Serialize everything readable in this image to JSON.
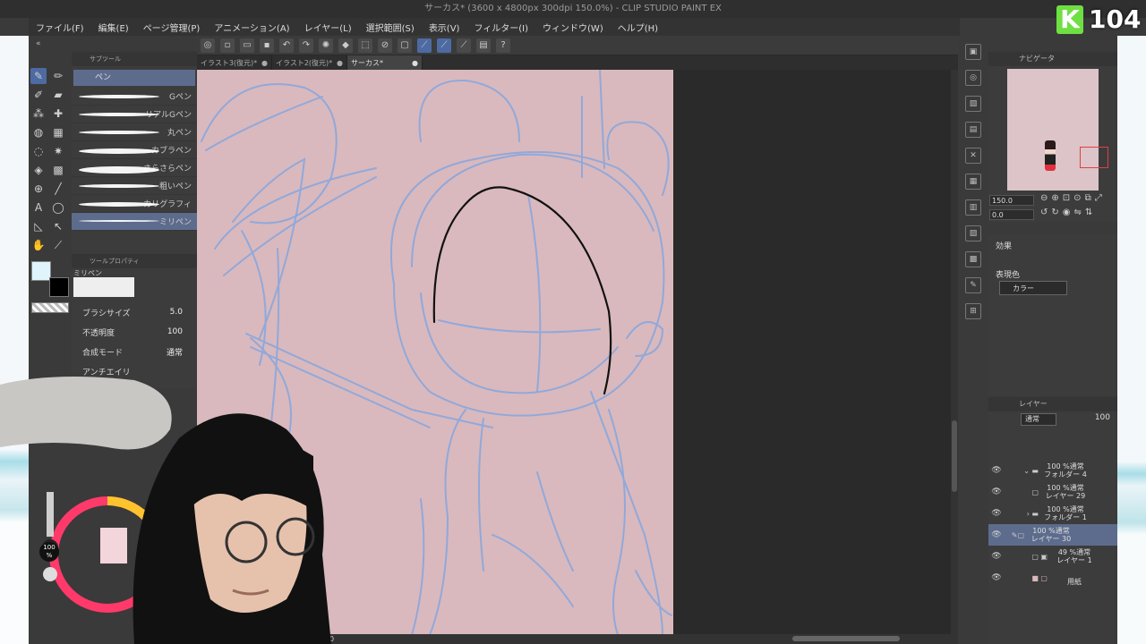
{
  "window": {
    "title": "サーカス* (3600 x 4800px 300dpi 150.0%) - CLIP STUDIO PAINT EX"
  },
  "menu": [
    "ファイル(F)",
    "編集(E)",
    "ページ管理(P)",
    "アニメーション(A)",
    "レイヤー(L)",
    "選択範囲(S)",
    "表示(V)",
    "フィルター(I)",
    "ウィンドウ(W)",
    "ヘルプ(H)"
  ],
  "tabs": [
    {
      "label": "イラスト3(復元)*"
    },
    {
      "label": "イラスト2(復元)*"
    },
    {
      "label": "サーカス*"
    }
  ],
  "subtool": {
    "title": "サブツール",
    "active": "ペン",
    "brushes": [
      "Gペン",
      "リアルGペン",
      "丸ペン",
      "カブラペン",
      "さらさらペン",
      "粗いペン",
      "カリグラフィ",
      "ミリペン"
    ]
  },
  "toolprop": {
    "title": "ツールプロパティ",
    "name": "ミリペン",
    "brush_size_label": "ブラシサイズ",
    "brush_size": "5.0",
    "opacity_label": "不透明度",
    "opacity": "100",
    "blend_label": "合成モード",
    "blend": "通常",
    "antialias_label": "アンチエイリ"
  },
  "navigator": {
    "title": "ナビゲータ",
    "zoom": "150.0",
    "rotation": "0.0"
  },
  "effects": {
    "title": "効果",
    "color_label": "表現色",
    "color_value": "カラー"
  },
  "layers": {
    "title": "レイヤー",
    "mode": "通常",
    "opacity": "100",
    "rows": [
      {
        "line1": "100 %通常",
        "line2": "フォルダー 4"
      },
      {
        "line1": "100 %通常",
        "line2": "レイヤー 29"
      },
      {
        "line1": "100 %通常",
        "line2": "フォルダー 1"
      },
      {
        "line1": "100 %通常",
        "line2": "レイヤー 30"
      },
      {
        "line1": "49 %通常",
        "line2": "レイヤー 1"
      },
      {
        "line1": "",
        "line2": "用紙"
      }
    ]
  },
  "color_slider": {
    "value": "100",
    "unit": "%"
  },
  "badge": {
    "letter": "K",
    "number": "104"
  },
  "hscroll": {
    "value": "0"
  },
  "colors": {
    "accent": "#4d6aa3",
    "paper": "#d9b9bd",
    "sketch": "#8aa7de"
  }
}
